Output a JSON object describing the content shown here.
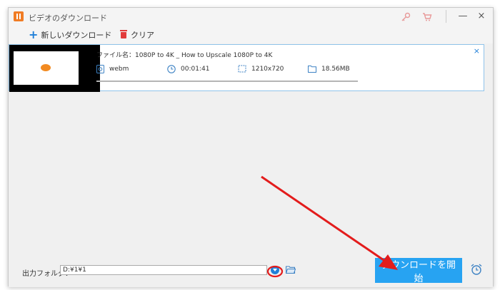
{
  "window": {
    "title": "ビデオのダウンロード"
  },
  "titlebar": {
    "icons": [
      "key-icon",
      "cart-icon"
    ],
    "minimize_glyph": "—",
    "close_glyph": "×"
  },
  "toolbar": {
    "new_download_label": "新しいダウンロード",
    "clear_label": "クリア"
  },
  "download_item": {
    "filename": "ファイル名：1080P to 4K _ How to Upscale 1080P to 4K",
    "format": "webm",
    "duration": "00:01:41",
    "resolution": "1210x720",
    "size": "18.56MB",
    "close_glyph": "×",
    "progress": 0
  },
  "bottom": {
    "output_folder_label": "出力フォルダ：",
    "output_path": "D:¥1¥1",
    "download_button_label": "ダウンロードを開始"
  },
  "colors": {
    "accent": "#27a3f2",
    "annotation": "#e31c1c",
    "brand_orange": "#f07c24"
  }
}
